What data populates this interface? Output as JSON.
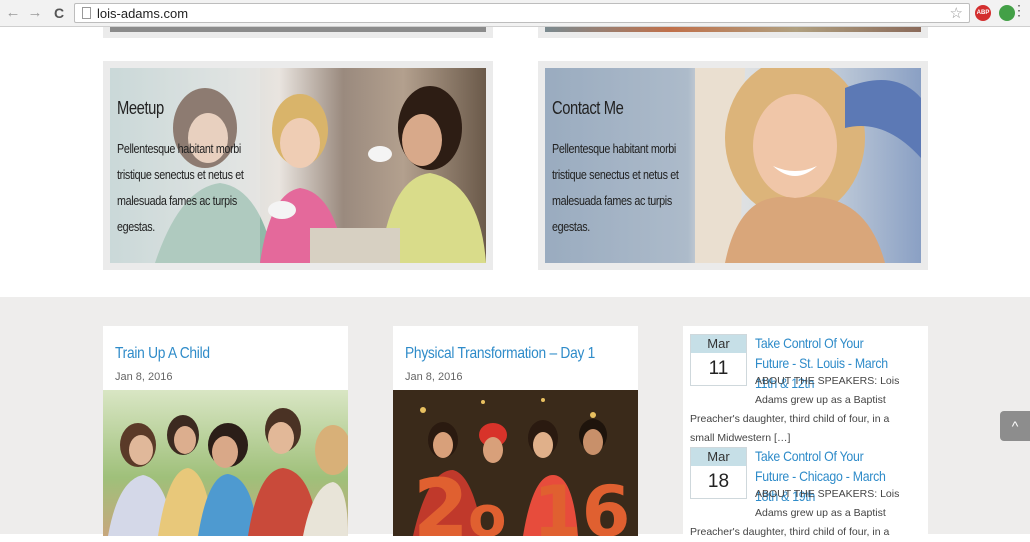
{
  "browser": {
    "url": "lois-adams.com",
    "back_icon": "←",
    "forward_icon": "→",
    "reload_icon": "C",
    "star_icon": "☆",
    "menu_icon": "⋮",
    "abp_label": "ABP"
  },
  "feature_cards": [
    {
      "title": "Meetup",
      "text": "Pellentesque habitant morbi tristique senectus et netus et malesuada fames ac turpis egestas."
    },
    {
      "title": "Contact Me",
      "text": "Pellentesque habitant morbi tristique senectus et netus et malesuada fames ac turpis egestas."
    }
  ],
  "posts": [
    {
      "title": "Train Up A Child",
      "date": "Jan 8, 2016"
    },
    {
      "title": "Physical Transformation – Day 1",
      "date": "Jan 8, 2016"
    }
  ],
  "events": [
    {
      "month": "Mar",
      "day": "11",
      "title": "Take Control Of Your Future - St. Louis - March 11th & 12th",
      "line1": "ABOUT THE SPEAKERS: Lois",
      "line2": "Adams grew up as a Baptist",
      "line3": "Preacher's daughter, third child of four, in a",
      "line4": "small Midwestern […]"
    },
    {
      "month": "Mar",
      "day": "18",
      "title": "Take Control Of Your Future - Chicago - March 18th & 19th",
      "line1": "ABOUT THE SPEAKERS: Lois",
      "line2": "Adams grew up as a Baptist",
      "line3": "Preacher's daughter, third child of four, in a"
    }
  ],
  "scroll_top_icon": "^"
}
